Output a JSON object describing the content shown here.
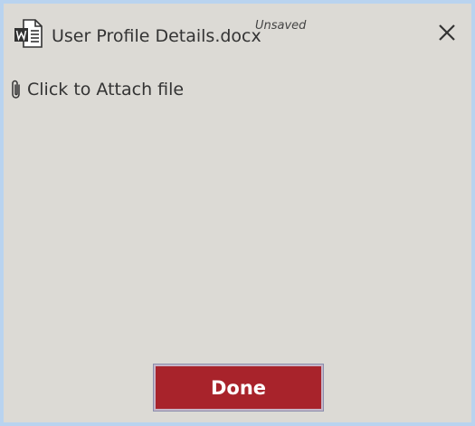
{
  "header": {
    "file_icon": "word-document-icon",
    "file_name": "User Profile Details.docx",
    "status": "Unsaved",
    "close_icon": "close-icon"
  },
  "attachment": {
    "icon": "paperclip-icon",
    "label": "Click to Attach file"
  },
  "footer": {
    "done_label": "Done",
    "done_color": "#a8232b"
  },
  "colors": {
    "background": "#dcdad5",
    "border": "#b9d3ef"
  }
}
